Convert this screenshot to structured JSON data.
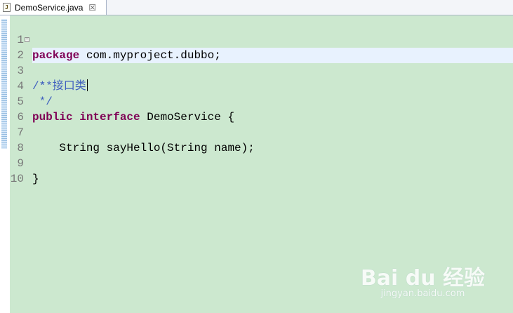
{
  "tab": {
    "label": "DemoService.java",
    "close": "☒",
    "icon_glyph": "J"
  },
  "colors": {
    "editor_bg": "#cce8cf",
    "keyword": "#7f0055",
    "comment": "#3f5fbf",
    "current_line": "#e8f2fe"
  },
  "code": {
    "line_numbers": [
      "1",
      "2",
      "3",
      "4",
      "5",
      "6",
      "7",
      "8",
      "9",
      "10"
    ],
    "l1_kw": "package",
    "l1_rest": " com.myproject.dubbo;",
    "l2_comment": "/**",
    "l2_fold": "−",
    "l3_comment": " * 接口类",
    "l4_comment": " */",
    "l5_kw1": "public",
    "l5_kw2": "interface",
    "l5_rest": " DemoService {",
    "l7_text": "    String sayHello(String name);",
    "l9_text": "}"
  },
  "watermark": {
    "logo": "Bai du 经验",
    "url": "jingyan.baidu.com"
  }
}
